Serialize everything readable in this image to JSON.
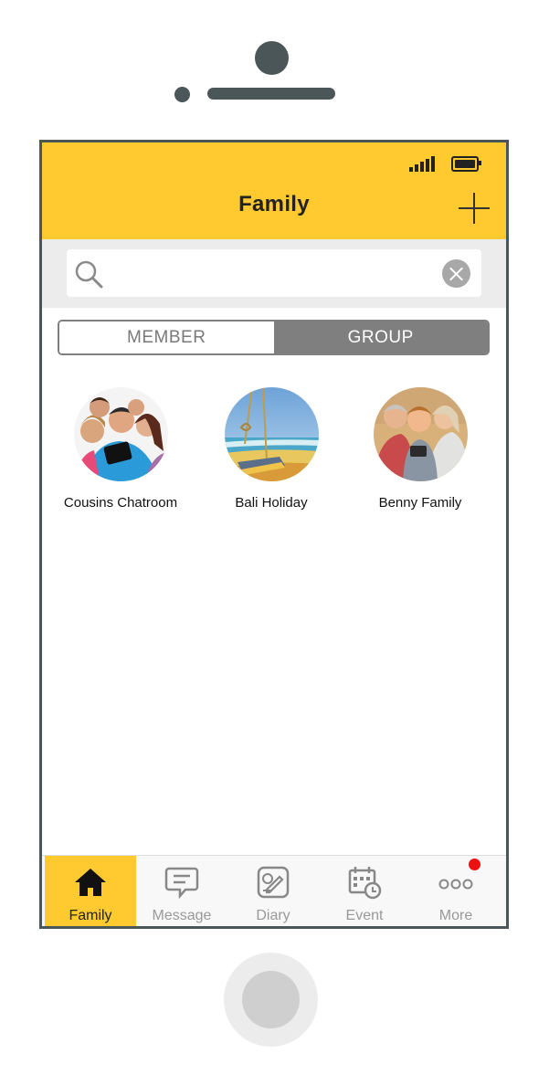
{
  "header": {
    "title": "Family",
    "add_icon": "plus-icon",
    "signal_icon": "signal-icon",
    "battery_icon": "battery-icon"
  },
  "search": {
    "placeholder": "",
    "value": "",
    "search_icon": "search-icon",
    "clear_icon": "clear-icon"
  },
  "segments": {
    "member_label": "MEMBER",
    "group_label": "GROUP",
    "selected": "GROUP"
  },
  "groups": [
    {
      "name": "Cousins Chatroom",
      "avatar": "group-photo"
    },
    {
      "name": "Bali Holiday",
      "avatar": "beach-swing-photo"
    },
    {
      "name": "Benny Family",
      "avatar": "family-photo"
    }
  ],
  "tabbar": {
    "active": "Family",
    "tabs": [
      {
        "label": "Family",
        "icon": "home-icon"
      },
      {
        "label": "Message",
        "icon": "chat-bubble-icon"
      },
      {
        "label": "Diary",
        "icon": "diary-icon"
      },
      {
        "label": "Event",
        "icon": "calendar-icon"
      },
      {
        "label": "More",
        "icon": "more-dots-icon",
        "notification": true
      }
    ]
  },
  "colors": {
    "accent": "#ffca30",
    "frame": "#4b5659",
    "segment_selected": "#7f7f7f",
    "badge": "#ee1111"
  }
}
